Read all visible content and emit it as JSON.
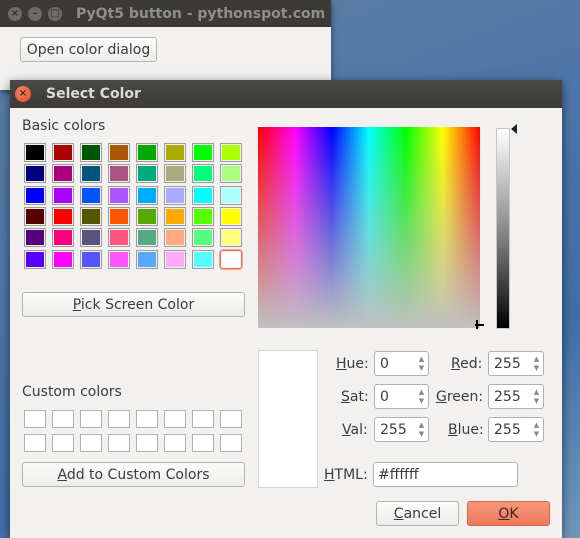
{
  "parent_window": {
    "title": "PyQt5 button - pythonspot.com",
    "button_label": "Open color dialog"
  },
  "dialog": {
    "title": "Select Color",
    "basic_colors_label": "Basic colors",
    "custom_colors_label": "Custom colors",
    "pick_screen_color": {
      "pre": "",
      "mnemonic": "P",
      "post": "ick Screen Color"
    },
    "add_to_custom": {
      "pre": "",
      "mnemonic": "A",
      "post": "dd to Custom Colors"
    },
    "basic_colors": [
      [
        "#000000",
        "#aa0000",
        "#005500",
        "#aa5500",
        "#00aa00",
        "#aaaa00",
        "#00ff00",
        "#aaff00"
      ],
      [
        "#00007f",
        "#aa007f",
        "#00557f",
        "#aa557f",
        "#00aa7f",
        "#aaaa7f",
        "#00ff7f",
        "#aaff7f"
      ],
      [
        "#0000ff",
        "#aa00ff",
        "#0055ff",
        "#aa55ff",
        "#00aaff",
        "#aaaaff",
        "#00ffff",
        "#aaffff"
      ],
      [
        "#550000",
        "#ff0000",
        "#555500",
        "#ff5500",
        "#55aa00",
        "#ffaa00",
        "#55ff00",
        "#ffff00"
      ],
      [
        "#55007f",
        "#ff007f",
        "#55557f",
        "#ff557f",
        "#55aa7f",
        "#ffaa7f",
        "#55ff7f",
        "#ffff7f"
      ],
      [
        "#5500ff",
        "#ff00ff",
        "#5555ff",
        "#ff55ff",
        "#55aaff",
        "#ffaaff",
        "#55ffff",
        "#ffffff"
      ]
    ],
    "selected_swatch": "#ffffff",
    "custom_colors": [
      "#ffffff",
      "#ffffff",
      "#ffffff",
      "#ffffff",
      "#ffffff",
      "#ffffff",
      "#ffffff",
      "#ffffff",
      "#ffffff",
      "#ffffff",
      "#ffffff",
      "#ffffff",
      "#ffffff",
      "#ffffff",
      "#ffffff",
      "#ffffff"
    ],
    "fields": {
      "hue": {
        "pre": "",
        "mnemonic": "H",
        "post": "ue:",
        "value": "0"
      },
      "sat": {
        "pre": "",
        "mnemonic": "S",
        "post": "at:",
        "value": "0"
      },
      "val": {
        "pre": "",
        "mnemonic": "V",
        "post": "al:",
        "value": "255"
      },
      "red": {
        "pre": "",
        "mnemonic": "R",
        "post": "ed:",
        "value": "255"
      },
      "green": {
        "pre": "",
        "mnemonic": "G",
        "post": "reen:",
        "value": "255"
      },
      "blue": {
        "pre": "",
        "mnemonic": "B",
        "post": "lue:",
        "value": "255"
      },
      "html": {
        "pre": "",
        "mnemonic": "H",
        "post": "TML:",
        "value": "#ffffff"
      }
    },
    "current_color": "#ffffff",
    "cancel": {
      "pre": "",
      "mnemonic": "C",
      "post": "ancel"
    },
    "ok": {
      "pre": "",
      "mnemonic": "O",
      "post": "K"
    }
  },
  "colors": {
    "accent": "#ee7a5c",
    "titlebar": "#3b3a36",
    "window_bg": "#f2f1f0"
  }
}
